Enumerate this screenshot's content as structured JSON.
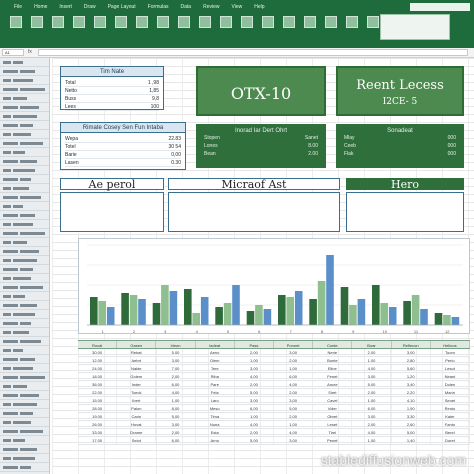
{
  "ribbon": {
    "tabs": [
      "File",
      "Home",
      "Insert",
      "Draw",
      "Page Layout",
      "Formulas",
      "Data",
      "Review",
      "View",
      "Help"
    ]
  },
  "formula_bar": {
    "name_box": "A1",
    "fx": "fx"
  },
  "panels": {
    "summary": {
      "title": "Tim Nate",
      "rows": [
        [
          "Total",
          "1 ,98"
        ],
        [
          "Netto",
          "1,85"
        ],
        [
          "Buss",
          "9,8"
        ],
        [
          "Lees",
          "100"
        ]
      ]
    },
    "notes": {
      "title": "Rimate Cosey Sen Fun Intaba",
      "rows": [
        [
          "Wepa",
          "22.83"
        ],
        [
          "Totel",
          "30 54"
        ],
        [
          "Barie",
          "0,00"
        ],
        [
          "Lasen",
          "0.30"
        ]
      ]
    }
  },
  "kpis": {
    "main": {
      "title": "OTX-10"
    },
    "recent": {
      "title": "Reent Lecess",
      "subtitle": "I2CE- 5"
    }
  },
  "stats": {
    "left": {
      "title": "Inorad Iar Dert Ohrt",
      "rows": [
        [
          "Stopen",
          "Sanet"
        ],
        [
          "Lones",
          "8.00"
        ],
        [
          "Bean",
          "2.00"
        ]
      ]
    },
    "right": {
      "title": "Sonadeat",
      "rows": [
        [
          "Mlay",
          "000"
        ],
        [
          "Ceeb",
          "000"
        ],
        [
          "Flak",
          "000"
        ]
      ]
    }
  },
  "banners": {
    "left": "Ae perol",
    "center": "Micraof Ast",
    "right": "Hero"
  },
  "chart_data": {
    "type": "bar",
    "categories": [
      "1",
      "2",
      "3",
      "4",
      "5",
      "6",
      "7",
      "8",
      "9",
      "10",
      "11",
      "12"
    ],
    "series": [
      {
        "values": [
          28,
          32,
          22,
          36,
          18,
          14,
          30,
          26,
          38,
          40,
          24,
          12
        ]
      },
      {
        "values": [
          24,
          30,
          40,
          12,
          22,
          20,
          28,
          44,
          20,
          22,
          30,
          10
        ]
      },
      {
        "values": [
          18,
          26,
          34,
          28,
          40,
          16,
          34,
          70,
          26,
          18,
          16,
          8
        ]
      }
    ],
    "ylim": [
      0,
      80
    ],
    "colors": [
      "#2e6a3a",
      "#8fbf8f",
      "#5b8fc9"
    ]
  },
  "table": {
    "headers": [
      "Rocal",
      "Gasen",
      "Irleon",
      "Iadeat",
      "Pass",
      "Ponnet",
      "Conte",
      "Boar",
      "Reflecon",
      "Helloos"
    ],
    "rows": [
      [
        "30.00",
        "Rebat",
        "5.00",
        "Aeno",
        "2,00",
        "3,00",
        "Nerie",
        "2.00",
        "3,00",
        "Toom"
      ],
      [
        "12.00",
        "Aebrt",
        "3,00",
        "Olem",
        "1,00",
        "2,00",
        "Bonte",
        "1.00",
        "2,80",
        "Perio"
      ],
      [
        "24.00",
        "Nable",
        "7,00",
        "Tere",
        "3,00",
        "1,00",
        "Eline",
        "4.00",
        "5,60",
        "Lesot"
      ],
      [
        "18.00",
        "Golem",
        "2,00",
        "Riba",
        "4,00",
        "6,00",
        "Fenet",
        "3.00",
        "1,20",
        "Neant"
      ],
      [
        "36.00",
        "Inder",
        "6,00",
        "Pare",
        "2,00",
        "4,00",
        "Ancre",
        "5.00",
        "3,40",
        "Dolen"
      ],
      [
        "22.00",
        "Toeck",
        "4,00",
        "Fela",
        "5,00",
        "2,00",
        "Siret",
        "2.00",
        "2,20",
        "Marin"
      ],
      [
        "15.00",
        "Ibert",
        "1,00",
        "Laro",
        "3,00",
        "3,00",
        "Cavel",
        "1.00",
        "4,10",
        "Senet"
      ],
      [
        "28.00",
        "Palon",
        "8,00",
        "Meso",
        "6,00",
        "5,00",
        "Voler",
        "6.00",
        "1,90",
        "Rento"
      ],
      [
        "19.00",
        "Carin",
        "5,00",
        "Tima",
        "1,00",
        "2,00",
        "Obret",
        "3.00",
        "3,30",
        "Kaler"
      ],
      [
        "26.00",
        "Hovat",
        "3,00",
        "Nuna",
        "4,00",
        "1,00",
        "Leset",
        "2.00",
        "2,60",
        "Fanto"
      ],
      [
        "33.00",
        "Drame",
        "2,00",
        "Esta",
        "2,00",
        "4,00",
        "Tirel",
        "4.00",
        "5,00",
        "Berel"
      ],
      [
        "17.00",
        "Selot",
        "6,00",
        "Arno",
        "5,00",
        "3,00",
        "Penet",
        "1.00",
        "1,40",
        "Doret"
      ]
    ]
  },
  "watermark": "stablediffusionweb.com"
}
